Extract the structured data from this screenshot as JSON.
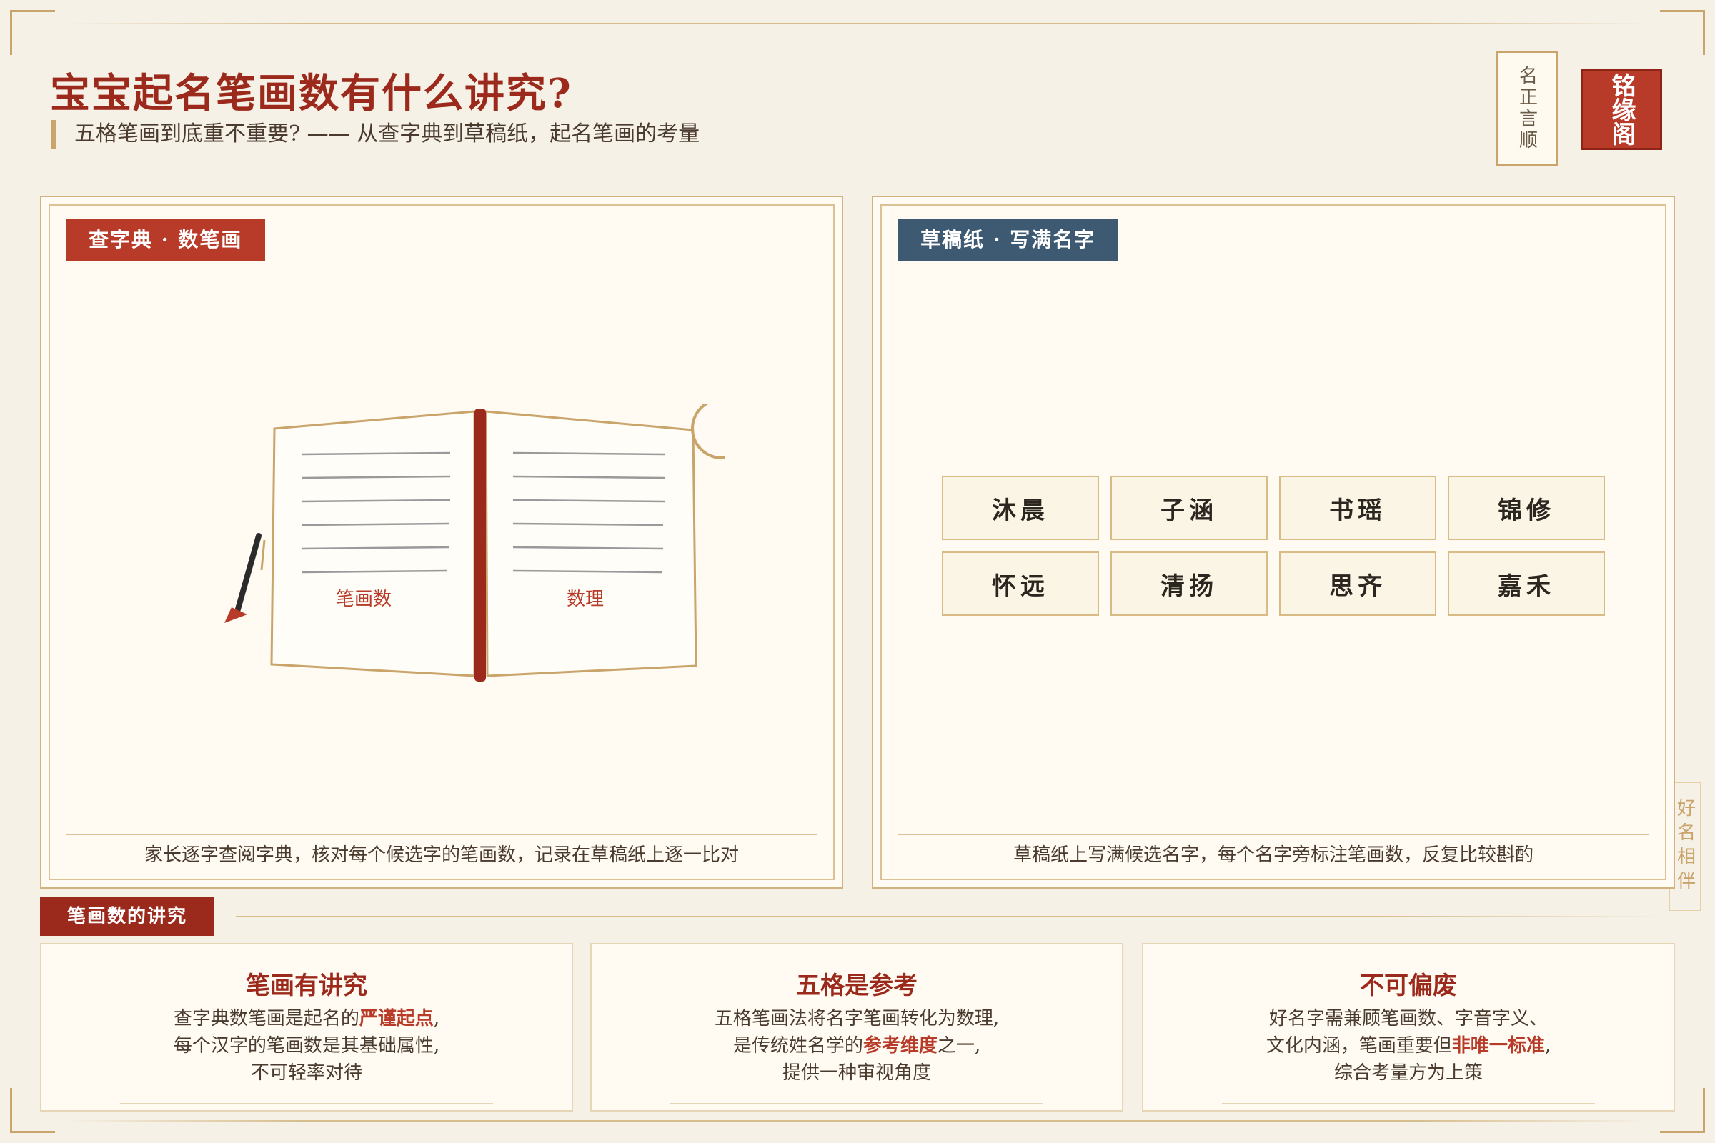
{
  "header": {
    "title": "宝宝起名笔画数有什么讲究?",
    "subtitle": "五格笔画到底重不重要? —— 从查字典到草稿纸，起名笔画的考量",
    "seal_text": "名正言顺",
    "brand": "铭缘阁"
  },
  "side_tag": "好名相伴",
  "left_panel": {
    "tag": "查字典 · 数笔画",
    "book_left_label": "笔画数",
    "book_right_label": "数理",
    "caption": "家长逐字查阅字典，核对每个候选字的笔画数，记录在草稿纸上逐一比对"
  },
  "right_panel": {
    "tag": "草稿纸 · 写满名字",
    "names": [
      "沐晨",
      "子涵",
      "书瑶",
      "锦修",
      "怀远",
      "清扬",
      "思齐",
      "嘉禾"
    ],
    "caption": "草稿纸上写满候选名字，每个名字旁标注笔画数，反复比较斟酌"
  },
  "section": {
    "title": "笔画数的讲究"
  },
  "cards": [
    {
      "title": "笔画有讲究",
      "l1a": "查字典数笔画是起名的",
      "l1h": "严谨起点",
      "l1b": ",",
      "l2": "每个汉字的笔画数是其基础属性,",
      "l3": "不可轻率对待"
    },
    {
      "title": "五格是参考",
      "l1": "五格笔画法将名字笔画转化为数理,",
      "l2a": "是传统姓名学的",
      "l2h": "参考维度",
      "l2b": "之一,",
      "l3": "提供一种审视角度"
    },
    {
      "title": "不可偏废",
      "l1": "好名字需兼顾笔画数、字音字义、",
      "l2a": "文化内涵，笔画重要但",
      "l2h": "非唯一标准",
      "l2b": ",",
      "l3": "综合考量方为上策"
    }
  ],
  "colors": {
    "accent": "#9c2a1c",
    "gold": "#c9a46b",
    "blue": "#3d5a72",
    "bg": "#f6f1e7"
  }
}
